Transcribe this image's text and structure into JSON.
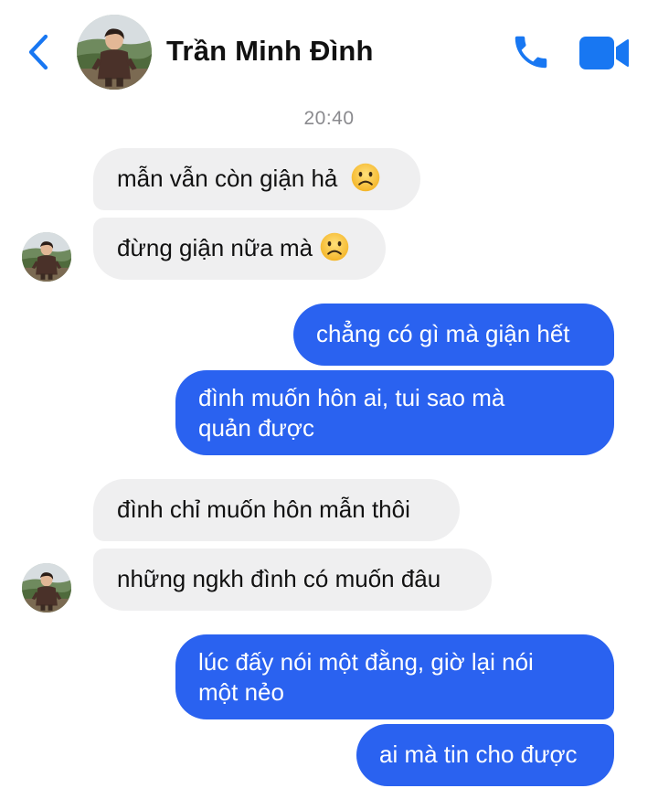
{
  "header": {
    "contact_name": "Trần Minh Đình"
  },
  "conversation": {
    "timestamp": "20:40",
    "messages": [
      {
        "sender": "contact",
        "text": "mẫn vẫn còn giận hả",
        "emoji": "frowning-face"
      },
      {
        "sender": "contact",
        "text": "đừng giận nữa mà",
        "emoji": "frowning-face"
      },
      {
        "sender": "me",
        "text": "chẳng có gì mà giận hết"
      },
      {
        "sender": "me",
        "lines": [
          "đình muốn hôn ai, tui sao mà",
          "quản được"
        ]
      },
      {
        "sender": "contact",
        "text": "đình chỉ muốn hôn mẫn thôi"
      },
      {
        "sender": "contact",
        "text": "những ngkh đình có muốn đâu"
      },
      {
        "sender": "me",
        "lines": [
          "lúc đấy nói một đằng, giờ lại nói",
          "một nẻo"
        ]
      },
      {
        "sender": "me",
        "text": "ai mà tin cho được"
      }
    ]
  },
  "colors": {
    "accent": "#1877f2",
    "outgoing_bubble": "#2a62f0",
    "incoming_bubble": "#efeff0",
    "timestamp": "#8a8a8e"
  },
  "icons": [
    "back-chevron-icon",
    "phone-icon",
    "video-camera-icon",
    "frowning-face-emoji"
  ]
}
